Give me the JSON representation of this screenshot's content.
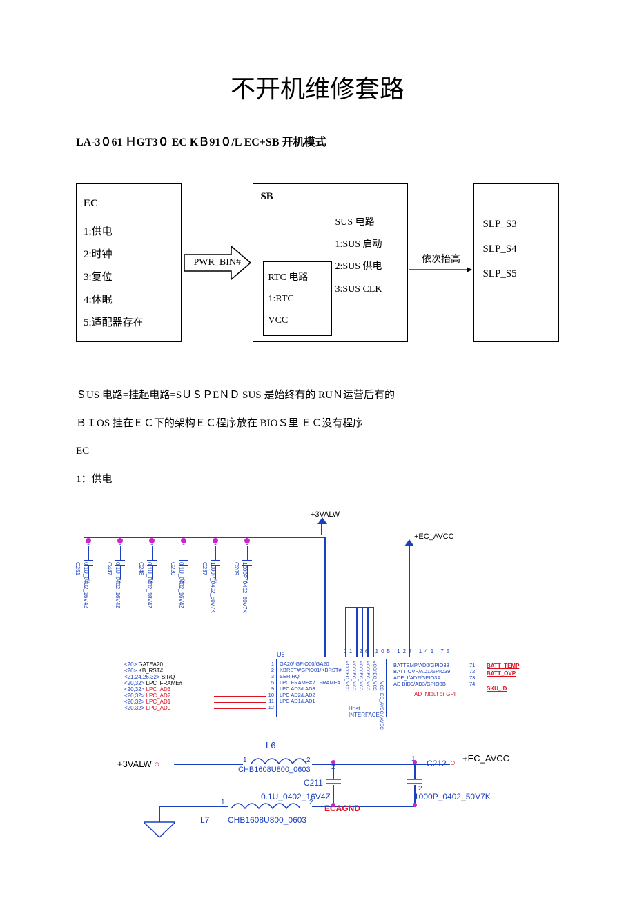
{
  "title": "不开机维修套路",
  "subtitle": "LA-3０61 ＨGT3０   EC   KＢ91０/L    EC+SB 开机模式",
  "ec": {
    "header": "EC",
    "items": [
      "1:供电",
      "2:时钟",
      "3:复位",
      "4:休眠",
      "5:适配器存在"
    ]
  },
  "arrow1_label": "PWR_BIN#",
  "sb": {
    "header": "SB",
    "sus_title": "SUS 电路",
    "sus_items": [
      "1:SUS 启动",
      "2:SUS 供电",
      "3:SUS CLK"
    ],
    "rtc_title": "RTC 电路",
    "rtc_items": [
      "1:RTC",
      "VCC"
    ]
  },
  "arrow2_label": "依次抬高",
  "slp": {
    "items": [
      "SLP_S3",
      "SLP_S4",
      "SLP_S5"
    ]
  },
  "para1": "ＳUS 电路=挂起电路=SＵＳＰEＮＤ          SUS 是始终有的    RUＮ运营后有的",
  "para2": "ＢＩOS 挂在ＥＣ下的架构ＥＣ程序放在 BIOＳ里    ＥＣ没有程序",
  "para3": "EC",
  "para4": "1：供电",
  "sch": {
    "toprail": "+3VALW",
    "avcc": "+EC_AVCC",
    "caps": [
      {
        "ref": "C251",
        "val": "0.1U_0402_16V4Z"
      },
      {
        "ref": "C447",
        "val": "0.1U_0402_16V4Z"
      },
      {
        "ref": "C248",
        "val": "0.1U_0402_18V4Z"
      },
      {
        "ref": "C220",
        "val": "0.1U_0402_16V4Z"
      },
      {
        "ref": "C237",
        "val": "1000P_0402_50V7K"
      },
      {
        "ref": "C209",
        "val": "1000P_0402_50V7K"
      }
    ],
    "u6": "U6",
    "left_pins": [
      {
        "idx": "<20>",
        "name": "GATEA20",
        "num": "1",
        "chip": "GA20/ GPIO00/GA20"
      },
      {
        "idx": "<20>",
        "name": "KB_RST#",
        "num": "2",
        "chip": "KBRST#/GPIO01/KBRST#"
      },
      {
        "idx": "<21,24,26,32>",
        "name": "SIRQ",
        "num": "3",
        "chip": "SERIRQ"
      },
      {
        "idx": "<20,32>",
        "name": "LPC_FRAME#",
        "num": "5",
        "chip": "LPC FRAME# / LFRAME#"
      },
      {
        "idx": "<20,32>",
        "name": "LPC_AD3",
        "num": "9",
        "chip": "LPC AD3/LAD3",
        "red": true
      },
      {
        "idx": "<20,32>",
        "name": "LPC_AD2",
        "num": "10",
        "chip": "LPC AD2/LAD2",
        "red": true
      },
      {
        "idx": "<20,32>",
        "name": "LPC_AD1",
        "num": "11",
        "chip": "LPC AD1/LAD1",
        "red": true
      },
      {
        "idx": "<20,32>",
        "name": "LPC_AD0",
        "num": "12",
        "chip": "",
        "red": true
      }
    ],
    "host_if1": "Host",
    "host_if2": "INTERFACE",
    "vcc_cols": [
      "VCC/ EC_VCC",
      "VCC/ EC_VCC",
      "VCC/ EC_VCC",
      "VCC/ EC_VCC",
      "VCC/ EC_VCC",
      "VCC",
      "EC_AVCC / AVCC"
    ],
    "vcc_pins": [
      "11",
      "26",
      "105",
      "127",
      "141",
      "75"
    ],
    "batt_pins": [
      {
        "name": "BATTEMP/AD0/GPIO38",
        "num": "71",
        "red": "BATT_TEMP"
      },
      {
        "name": "BATT OVP/AD1/GPIO39",
        "num": "72",
        "red": "BATT_OVP"
      },
      {
        "name": "ADP_I/AD2/GPIO3A",
        "num": "73",
        "red": ""
      },
      {
        "name": "AD BID0/AD3/GPIO3B",
        "num": "74",
        "red": "SKU_ID"
      }
    ],
    "ad_note": "AD INtput or GPI",
    "lc": {
      "valw": "+3VALW",
      "L6": "L6",
      "L6_part": "CHB1608U800_0603",
      "C211": "C211",
      "C211_val": "0.1U_0402_16V4Z",
      "C212": "C212",
      "C212_val": "1000P_0402_50V7K",
      "avcc": "+EC_AVCC",
      "ecagnd": "ECAGND",
      "L7": "L7",
      "L7_part": "CHB1608U800_0603",
      "pin1": "1",
      "pin2": "2"
    }
  }
}
